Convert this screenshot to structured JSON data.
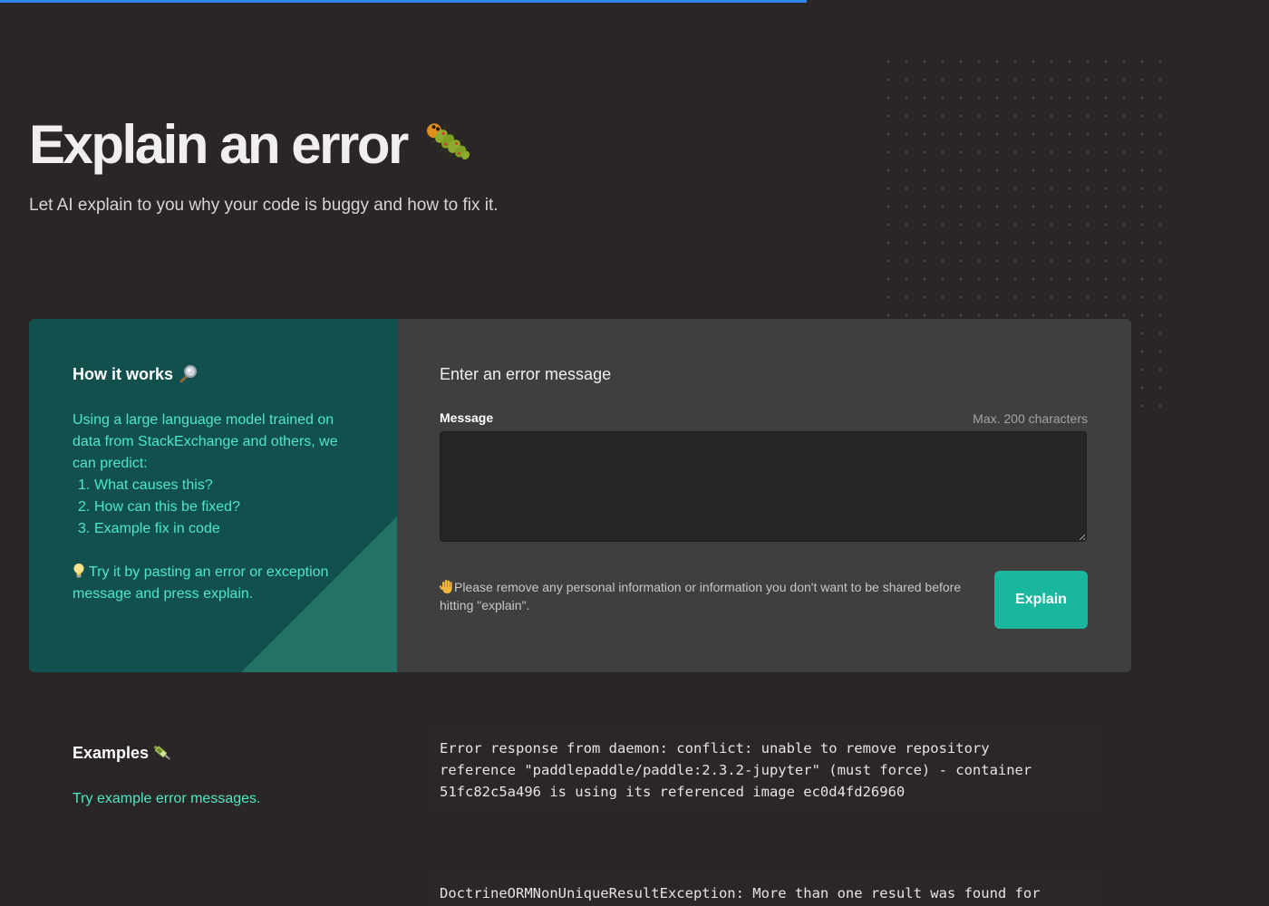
{
  "progress": {
    "fraction": 0.636
  },
  "colors": {
    "background": "#2a2526",
    "accent": "#19b89e",
    "teal_panel": "#11504c",
    "teal_text": "#4ee8c4",
    "progress": "#2f86e6"
  },
  "hero": {
    "title": "Explain an error",
    "title_icon": "caterpillar-bug-icon",
    "subtitle": "Let AI explain to you why your code is buggy and how to fix it."
  },
  "how_it_works": {
    "title": "How it works",
    "title_icon": "magnifier-icon",
    "description": "Using a large language model trained on data from StackExchange and others, we can predict:",
    "steps": [
      {
        "num": "1.",
        "text": "What causes this?"
      },
      {
        "num": "2.",
        "text": "How can this be fixed?"
      },
      {
        "num": "3.",
        "text": "Example fix in code"
      }
    ],
    "tip_icon": "lightbulb-icon",
    "tip": "Try it by pasting an error or exception message and press explain."
  },
  "form": {
    "title": "Enter an error message",
    "message_label": "Message",
    "message_hint": "Max. 200 characters",
    "message_value": "",
    "privacy_icon": "raised-hand-icon",
    "privacy_note": "Please remove any personal information or information you don't want to be shared before hitting \"explain\".",
    "submit_label": "Explain"
  },
  "examples": {
    "title": "Examples",
    "title_icon": "syringe-icon",
    "description": "Try example error messages.",
    "items": [
      "Error response from daemon: conflict: unable to remove repository\nreference \"paddlepaddle/paddle:2.3.2-jupyter\" (must force) - container\n51fc82c5a496 is using its referenced image ec0d4fd26960",
      "DoctrineORMNonUniqueResultException: More than one result was found for"
    ]
  }
}
